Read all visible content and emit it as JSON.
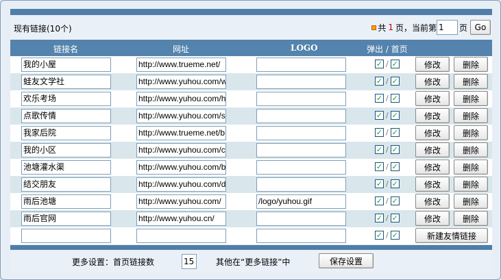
{
  "header": {
    "existing_links": "现有链接(10个)",
    "pager": {
      "total_prefix": "共",
      "total_pages": "1",
      "total_suffix": "页，当前第",
      "current_page": "1",
      "page_unit": "页",
      "go_label": "Go"
    }
  },
  "table": {
    "columns": {
      "name": "链接名",
      "url": "网址",
      "logo": "LOGO",
      "popup_home": "弹出 / 首页"
    },
    "check_separator": "/",
    "edit_label": "修改",
    "delete_label": "删除",
    "new_label": "新建友情链接",
    "rows": [
      {
        "name": "我的小屋",
        "url": "http://www.trueme.net/",
        "logo": "",
        "popup": true,
        "home": true
      },
      {
        "name": "蛙友文学社",
        "url": "http://www.yuhou.com/w",
        "logo": "",
        "popup": true,
        "home": true
      },
      {
        "name": "欢乐考场",
        "url": "http://www.yuhou.com/h",
        "logo": "",
        "popup": true,
        "home": true
      },
      {
        "name": "点歌传情",
        "url": "http://www.yuhou.com/s",
        "logo": "",
        "popup": true,
        "home": true
      },
      {
        "name": "我家后院",
        "url": "http://www.trueme.net/b",
        "logo": "",
        "popup": true,
        "home": true
      },
      {
        "name": "我的小区",
        "url": "http://www.yuhou.com/c",
        "logo": "",
        "popup": true,
        "home": true
      },
      {
        "name": "池塘灌水渠",
        "url": "http://www.yuhou.com/b",
        "logo": "",
        "popup": true,
        "home": true
      },
      {
        "name": "结交朋友",
        "url": "http://www.yuhou.com/d",
        "logo": "",
        "popup": true,
        "home": true
      },
      {
        "name": "雨后池塘",
        "url": "http://www.yuhou.com/",
        "logo": "/logo/yuhou.gif",
        "popup": true,
        "home": true
      },
      {
        "name": "雨后官网",
        "url": "http://www.yuhou.cn/",
        "logo": "",
        "popup": true,
        "home": true
      }
    ],
    "new_row": {
      "name": "",
      "url": "",
      "logo": "",
      "popup": true,
      "home": true
    }
  },
  "footer": {
    "more_settings_label": "更多设置：首页链接数",
    "home_links_count": "15",
    "others_label": "其他在“更多链接”中",
    "save_label": "保存设置"
  },
  "colors": {
    "header_blue": "#5483ad",
    "row_alt": "#d9e7ec",
    "page_count_red": "#c00000",
    "check_green": "#21a121"
  }
}
